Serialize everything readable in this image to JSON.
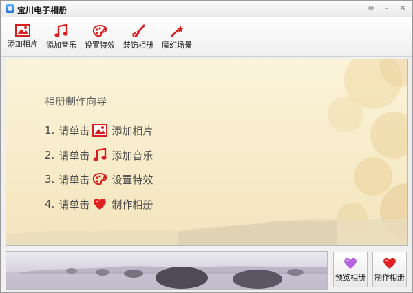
{
  "window": {
    "title": "宝川电子相册"
  },
  "toolbar": {
    "items": [
      {
        "label": "添加相片",
        "icon": "photo-icon"
      },
      {
        "label": "添加音乐",
        "icon": "music-note-icon"
      },
      {
        "label": "设置特效",
        "icon": "palette-icon"
      },
      {
        "label": "装饰相册",
        "icon": "brush-icon"
      },
      {
        "label": "魔幻场景",
        "icon": "magic-wand-icon"
      }
    ]
  },
  "wizard": {
    "title": "相册制作向导",
    "steps": [
      {
        "number": "1.",
        "prefix": "请单击",
        "action": "添加相片",
        "icon": "photo-icon"
      },
      {
        "number": "2.",
        "prefix": "请单击",
        "action": "添加音乐",
        "icon": "music-note-icon"
      },
      {
        "number": "3.",
        "prefix": "请单击",
        "action": "设置特效",
        "icon": "palette-icon"
      },
      {
        "number": "4.",
        "prefix": "请单击",
        "action": "制作相册",
        "icon": "heart-icon"
      }
    ]
  },
  "bottom": {
    "preview_label": "预览相册",
    "preview_icon": "purple-heart-icon",
    "make_label": "制作相册",
    "make_icon": "red-heart-icon"
  },
  "colors": {
    "accent_red": "#d81e1e",
    "heart_purple": "#b564e0"
  }
}
